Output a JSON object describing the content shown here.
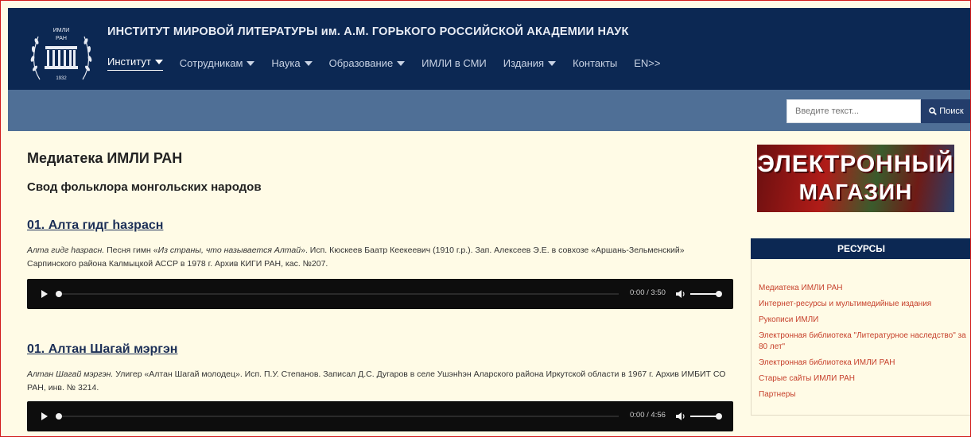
{
  "header": {
    "logo": {
      "top_text": "ИМЛИ",
      "sub_text": "РАН",
      "year": "1932"
    },
    "title": "ИНСТИТУТ МИРОВОЙ ЛИТЕРАТУРЫ им. А.М. ГОРЬКОГО РОССИЙСКОЙ АКАДЕМИИ НАУК",
    "nav": [
      {
        "label": "Институт",
        "dropdown": true
      },
      {
        "label": "Сотрудникам",
        "dropdown": true
      },
      {
        "label": "Наука",
        "dropdown": true
      },
      {
        "label": "Образование",
        "dropdown": true
      },
      {
        "label": "ИМЛИ в СМИ",
        "dropdown": false
      },
      {
        "label": "Издания",
        "dropdown": true
      },
      {
        "label": "Контакты",
        "dropdown": false
      },
      {
        "label": "EN>>",
        "dropdown": false
      }
    ]
  },
  "search": {
    "placeholder": "Введите текст...",
    "button_label": "Поиск"
  },
  "main": {
    "page_title": "Медиатека ИМЛИ РАН",
    "subtitle": "Свод фольклора монгольских народов",
    "tracks": [
      {
        "title": "01. Алта гидг һазрасн",
        "desc_italic": "Алта гидг һазрасн.",
        "desc_mid": " Песня гимн «",
        "desc_italic2": "Из страны, что называется Алтай",
        "desc_rest": "». Исп. Кюскеев Баатр Кеекеевич (1910 г.р.). Зап. Алексеев Э.Е. в совхозе «Аршань-Зельменский» Сарпинского района Калмыцкой АССР в 1978 г. Архив КИГИ РАН, кас. №207.",
        "time": "0:00 / 3:50",
        "progress": 0
      },
      {
        "title": "01. Алтан Шагай мэргэн",
        "desc_italic": "Алтан Шагай мэргэн.",
        "desc_mid": " Улигер «Алтан Шагай молодец». Исп. П.У. Степанов. Записал Д.С. Дугаров в селе Ушэнһэн Аларского района Иркутской области в 1967 г. Архив ИМБИТ СО РАН, инв. № 3214.",
        "desc_italic2": "",
        "desc_rest": "",
        "time": "0:00 / 4:56",
        "progress": 0
      }
    ]
  },
  "sidebar": {
    "banner": {
      "line1": "ЭЛЕКТРОННЫЙ",
      "line2": "МАГАЗИН"
    },
    "resources_title": "РЕСУРСЫ",
    "resources": [
      "Медиатека ИМЛИ РАН",
      "Интернет-ресурсы и мультимедийные издания",
      "Рукописи ИМЛИ",
      "Электронная библиотека \"Литературное наследство\" за 80 лет\"",
      "Электронная библиотека ИМЛИ РАН",
      "Старые сайты ИМЛИ РАН",
      "Партнеры"
    ]
  },
  "colors": {
    "header_bg": "#0c2853",
    "strip_bg": "#4f6f96",
    "page_bg": "#fffbe6",
    "link": "#c6402b"
  }
}
